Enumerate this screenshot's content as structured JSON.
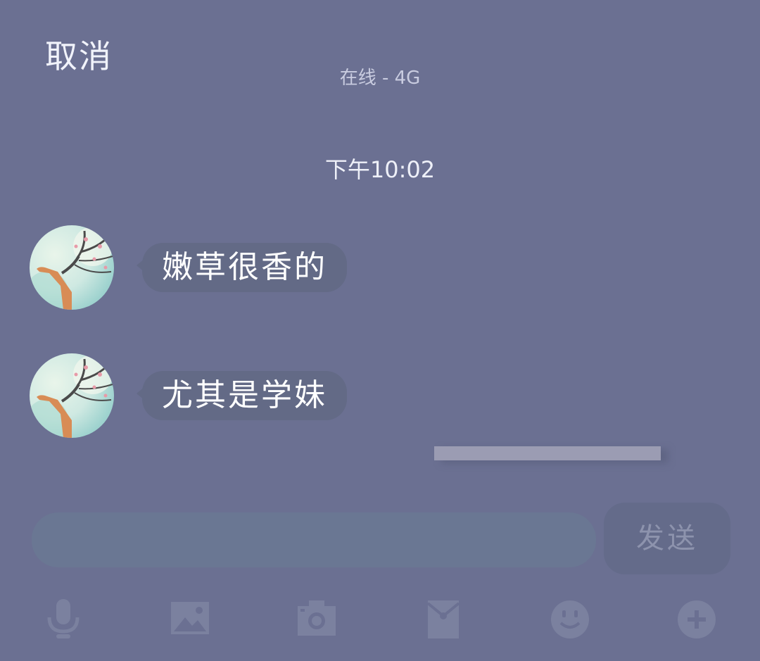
{
  "header": {
    "cancel_label": "取消",
    "status": "在线 - 4G"
  },
  "chat": {
    "timestamp": "下午10:02",
    "messages": [
      {
        "text": "嫩草很香的",
        "side": "left",
        "avatar": "deer-avatar"
      },
      {
        "text": "尤其是学妹",
        "side": "left",
        "avatar": "deer-avatar"
      }
    ]
  },
  "composer": {
    "input_value": "",
    "input_placeholder": "",
    "send_label": "发送"
  },
  "toolbar": {
    "icons": [
      "microphone-icon",
      "image-icon",
      "camera-icon",
      "red-envelope-icon",
      "emoji-icon",
      "plus-icon"
    ]
  },
  "colors": {
    "background": "#6b7092",
    "bubble": "#636a86",
    "input": "#6a7793",
    "send_button": "#646b8a",
    "toolbar_icon": "#7b819f"
  }
}
